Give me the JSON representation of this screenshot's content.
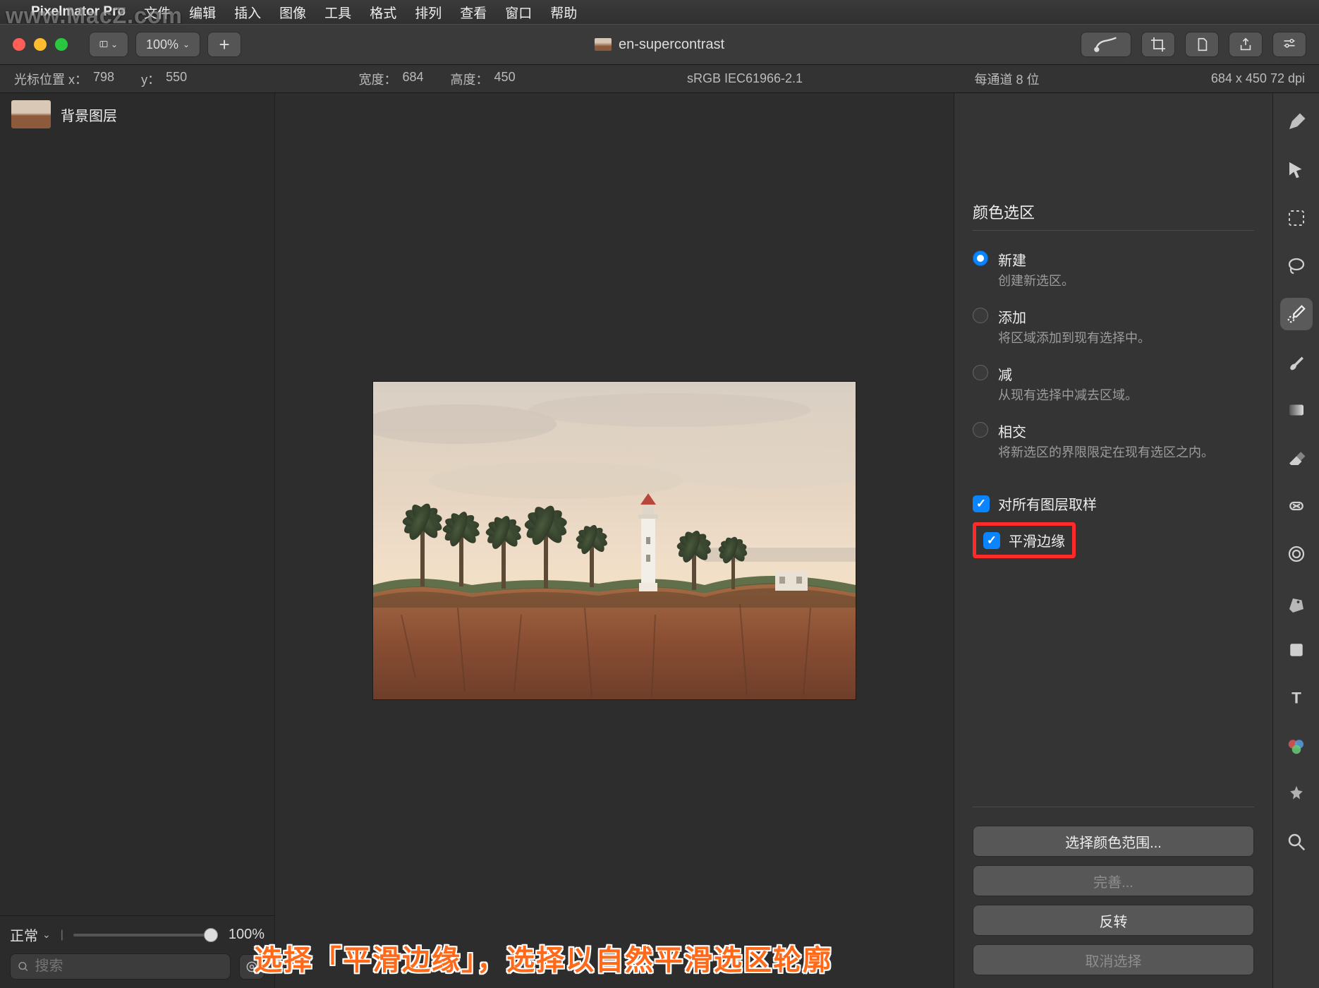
{
  "watermark": "www.MacZ.com",
  "menubar": {
    "app_name": "Pixelmator Pro",
    "items": [
      "文件",
      "编辑",
      "插入",
      "图像",
      "工具",
      "格式",
      "排列",
      "查看",
      "窗口",
      "帮助"
    ]
  },
  "toolbar": {
    "zoom_label": "100%",
    "doc_title": "en-supercontrast"
  },
  "info_strip": {
    "cursor_label": "光标位置 x：",
    "cursor_x": "798",
    "cursor_y_label": "y：",
    "cursor_y": "550",
    "width_label": "宽度：",
    "width": "684",
    "height_label": "高度：",
    "height": "450",
    "color_profile": "sRGB IEC61966-2.1",
    "bit_depth": "每通道 8 位",
    "dims_dpi": "684 x 450 72 dpi"
  },
  "layers": {
    "items": [
      {
        "name": "背景图层"
      }
    ],
    "blend_mode": "正常",
    "opacity": "100%",
    "search_placeholder": "搜索"
  },
  "inspector": {
    "title": "颜色选区",
    "modes": [
      {
        "label": "新建",
        "desc": "创建新选区。",
        "checked": true
      },
      {
        "label": "添加",
        "desc": "将区域添加到现有选择中。",
        "checked": false
      },
      {
        "label": "减",
        "desc": "从现有选择中减去区域。",
        "checked": false
      },
      {
        "label": "相交",
        "desc": "将新选区的界限限定在现有选区之内。",
        "checked": false
      }
    ],
    "sample_all_label": "对所有图层取样",
    "smooth_edges_label": "平滑边缘",
    "btn_color_range": "选择颜色范围...",
    "btn_refine": "完善...",
    "btn_invert": "反转",
    "btn_deselect": "取消选择"
  },
  "annotation_text": "选择「平滑边缘」，选择以自然平滑选区轮廓",
  "tool_names": [
    "style-tool",
    "arrow-tool",
    "marquee-tool",
    "lasso-tool",
    "color-select-tool",
    "paint-tool",
    "gradient-tool",
    "erase-tool",
    "repair-tool",
    "warp-tool",
    "pen-tool",
    "shape-tool",
    "type-tool",
    "color-picker-tool",
    "effects-tool",
    "zoom-tool"
  ]
}
